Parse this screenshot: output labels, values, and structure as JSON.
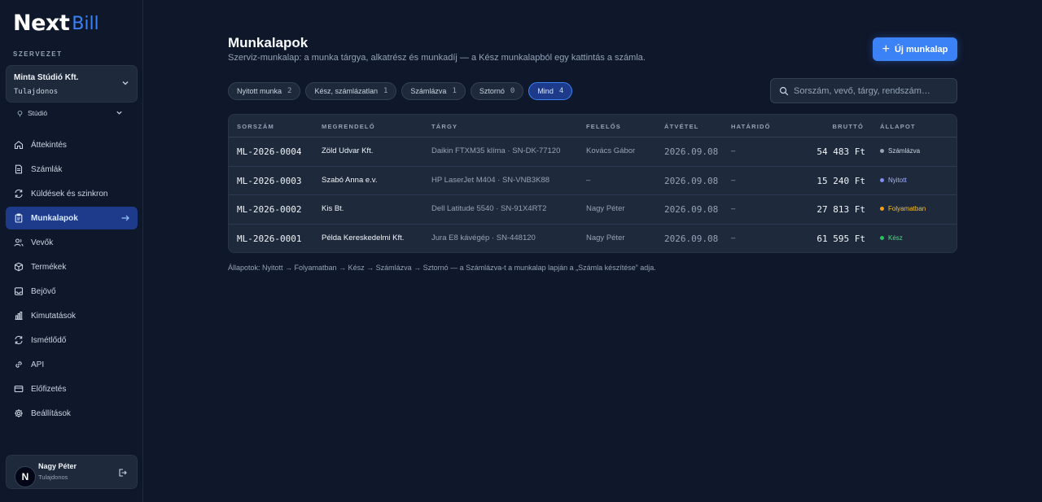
{
  "brand": {
    "logo_main": "Next",
    "logo_accent": "Bill"
  },
  "sidebar": {
    "org_label": "SZERVEZET",
    "org_name": "Minta Stúdió Kft.",
    "org_role": "Tulajdonos",
    "profile": "Stúdió",
    "items": [
      {
        "label": "Áttekintés",
        "icon": "home-icon"
      },
      {
        "label": "Számlák",
        "icon": "document-icon"
      },
      {
        "label": "Küldések és szinkron",
        "icon": "sync-icon"
      },
      {
        "label": "Munkalapok",
        "icon": "clipboard-icon",
        "active": true
      },
      {
        "label": "Vevők",
        "icon": "users-icon"
      },
      {
        "label": "Termékek",
        "icon": "box-icon"
      },
      {
        "label": "Bejövő",
        "icon": "inbox-icon"
      },
      {
        "label": "Kimutatások",
        "icon": "chart-icon"
      },
      {
        "label": "Ismétlődő",
        "icon": "repeat-icon"
      },
      {
        "label": "API",
        "icon": "link-icon"
      },
      {
        "label": "Előfizetés",
        "icon": "card-icon"
      },
      {
        "label": "Beállítások",
        "icon": "gear-icon"
      }
    ],
    "user": {
      "initial": "N",
      "name": "Nagy Péter",
      "role": "Tulajdonos"
    }
  },
  "main": {
    "title": "Munkalapok",
    "subtitle": "Szerviz-munkalap: a munka tárgya, alkatrész és munkadíj — a Kész munkalapból egy kattintás a számla.",
    "new_button": "Új munkalap",
    "filters": [
      {
        "label": "Nyitott munka",
        "count": "2"
      },
      {
        "label": "Kész, számlázatlan",
        "count": "1"
      },
      {
        "label": "Számlázva",
        "count": "1"
      },
      {
        "label": "Sztornó",
        "count": "0"
      },
      {
        "label": "Mind",
        "count": "4",
        "active": true
      }
    ],
    "search_placeholder": "Sorszám, vevő, tárgy, rendszám…",
    "columns": [
      "SORSZÁM",
      "MEGRENDELŐ",
      "TÁRGY",
      "FELELŐS",
      "ÁTVÉTEL",
      "HATÁRIDŐ",
      "BRUTTÓ",
      "ÁLLAPOT"
    ],
    "rows": [
      {
        "id": "ML-2026-0004",
        "customer": "Zöld Udvar Kft.",
        "subject": "Daikin FTXM35 klíma · SN-DK-77120",
        "responsible": "Kovács Gábor",
        "received": "2026.09.08",
        "due": "–",
        "gross": "54 483 Ft",
        "status": "Számlázva",
        "status_color": "#94a3b8"
      },
      {
        "id": "ML-2026-0003",
        "customer": "Szabó Anna e.v.",
        "subject": "HP LaserJet M404 · SN-VNB3K88",
        "responsible": "–",
        "received": "2026.09.08",
        "due": "–",
        "gross": "15 240 Ft",
        "status": "Nyitott",
        "status_color": "#818cf8"
      },
      {
        "id": "ML-2026-0002",
        "customer": "Kis Bt.",
        "subject": "Dell Latitude 5540 · SN-91X4RT2",
        "responsible": "Nagy Péter",
        "received": "2026.09.08",
        "due": "–",
        "gross": "27 813 Ft",
        "status": "Folyamatban",
        "status_color": "#f59e0b"
      },
      {
        "id": "ML-2026-0001",
        "customer": "Példa Kereskedelmi Kft.",
        "subject": "Jura E8 kávégép · SN-448120",
        "responsible": "Nagy Péter",
        "received": "2026.09.08",
        "due": "–",
        "gross": "61 595 Ft",
        "status": "Kész",
        "status_color": "#22c55e"
      }
    ],
    "footnote": "Állapotok: Nyitott → Folyamatban → Kész → Számlázva → Sztornó — a Számlázva-t a munkalap lapján a „Számla készítése” adja."
  }
}
